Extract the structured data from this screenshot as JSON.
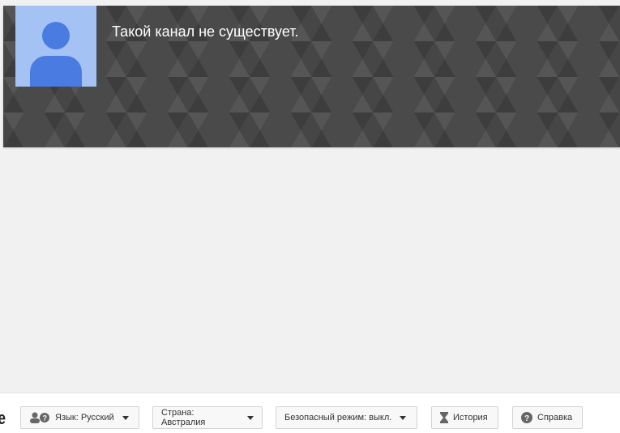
{
  "channel": {
    "message": "Такой канал не существует."
  },
  "footer": {
    "logo_text": "YouTube",
    "language": "Язык: Русский",
    "country": "Страна: Австралия",
    "safety": "Безопасный режим: выкл.",
    "history": "История",
    "help": "Справка"
  }
}
